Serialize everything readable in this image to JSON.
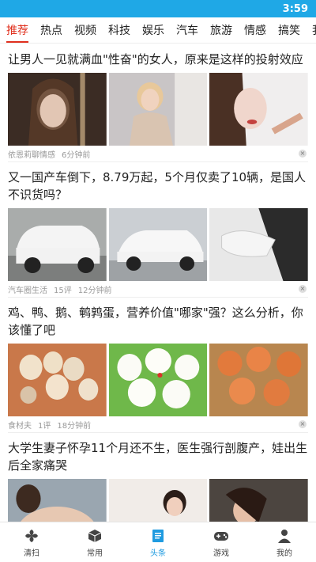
{
  "status_bar": {
    "time": "3:59"
  },
  "tabs": [
    {
      "label": "推荐",
      "active": true
    },
    {
      "label": "热点"
    },
    {
      "label": "视频"
    },
    {
      "label": "科技"
    },
    {
      "label": "娱乐"
    },
    {
      "label": "汽车"
    },
    {
      "label": "旅游"
    },
    {
      "label": "情感"
    },
    {
      "label": "搞笑"
    },
    {
      "label": "我"
    }
  ],
  "articles": [
    {
      "title": "让男人一见就满血\"性奋\"的女人，原来是这样的投射效应",
      "source": "依恩莉聊情感",
      "time": "6分钟前",
      "images": [
        "portrait-woman-hair",
        "blonde-woman-posing",
        "makeup-woman"
      ]
    },
    {
      "title": "又一国产车倒下，8.79万起，5个月仅卖了10辆，是国人不识货吗？",
      "source": "汽车圈生活",
      "comments": "15评",
      "time": "12分钟前",
      "images": [
        "white-suv-front",
        "white-suv-side",
        "car-mirror-closeup"
      ]
    },
    {
      "title": "鸡、鸭、鹅、鹌鹑蛋，营养价值\"哪家\"强？这么分析，你该懂了吧",
      "source": "食材夫",
      "comments": "1评",
      "time": "18分钟前",
      "images": [
        "assorted-eggs",
        "peeled-eggs-lettuce",
        "brown-eggs-basket"
      ]
    },
    {
      "title": "大学生妻子怀孕11个月还不生，医生强行剖腹产，娃出生后全家痛哭",
      "images": [
        "pregnant-woman",
        "woman-hospital",
        "woman-lying"
      ]
    }
  ],
  "bottom_nav": [
    {
      "label": "清扫",
      "icon": "fan-icon"
    },
    {
      "label": "常用",
      "icon": "cube-icon"
    },
    {
      "label": "头条",
      "icon": "news-icon",
      "active": true
    },
    {
      "label": "游戏",
      "icon": "gamepad-icon"
    },
    {
      "label": "我的",
      "icon": "person-icon"
    }
  ],
  "colors": {
    "accent": "#1fa8e6",
    "active_tab": "#e0301e",
    "nav_active": "#1f9be0"
  }
}
